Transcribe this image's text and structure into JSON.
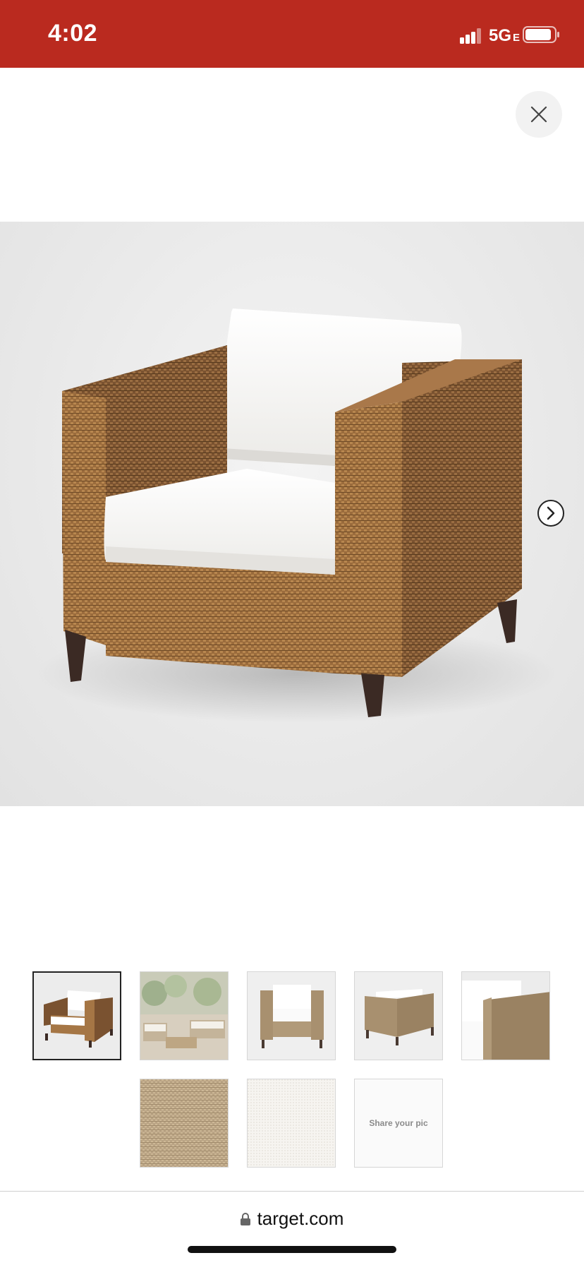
{
  "status_bar": {
    "time": "4:02",
    "network": "5G",
    "network_sub": "E",
    "background_color": "#ba2a1f",
    "signal_icon": "signal-bars-icon",
    "battery_icon": "battery-icon"
  },
  "viewer": {
    "close_icon": "close-icon",
    "next_icon": "chevron-right-icon",
    "image_subject": "wicker club chair with white cushions"
  },
  "thumbnails": [
    {
      "id": "chair-front-angle",
      "active": true
    },
    {
      "id": "patio-scene",
      "active": false
    },
    {
      "id": "chair-front",
      "active": false
    },
    {
      "id": "chair-back",
      "active": false
    },
    {
      "id": "chair-side-detail",
      "active": false
    },
    {
      "id": "wicker-texture",
      "active": false
    },
    {
      "id": "cushion-texture",
      "active": false
    },
    {
      "id": "share-your-pic",
      "active": false,
      "label": "Share your pic"
    }
  ],
  "address_bar": {
    "domain": "target.com",
    "lock_icon": "lock-icon"
  }
}
